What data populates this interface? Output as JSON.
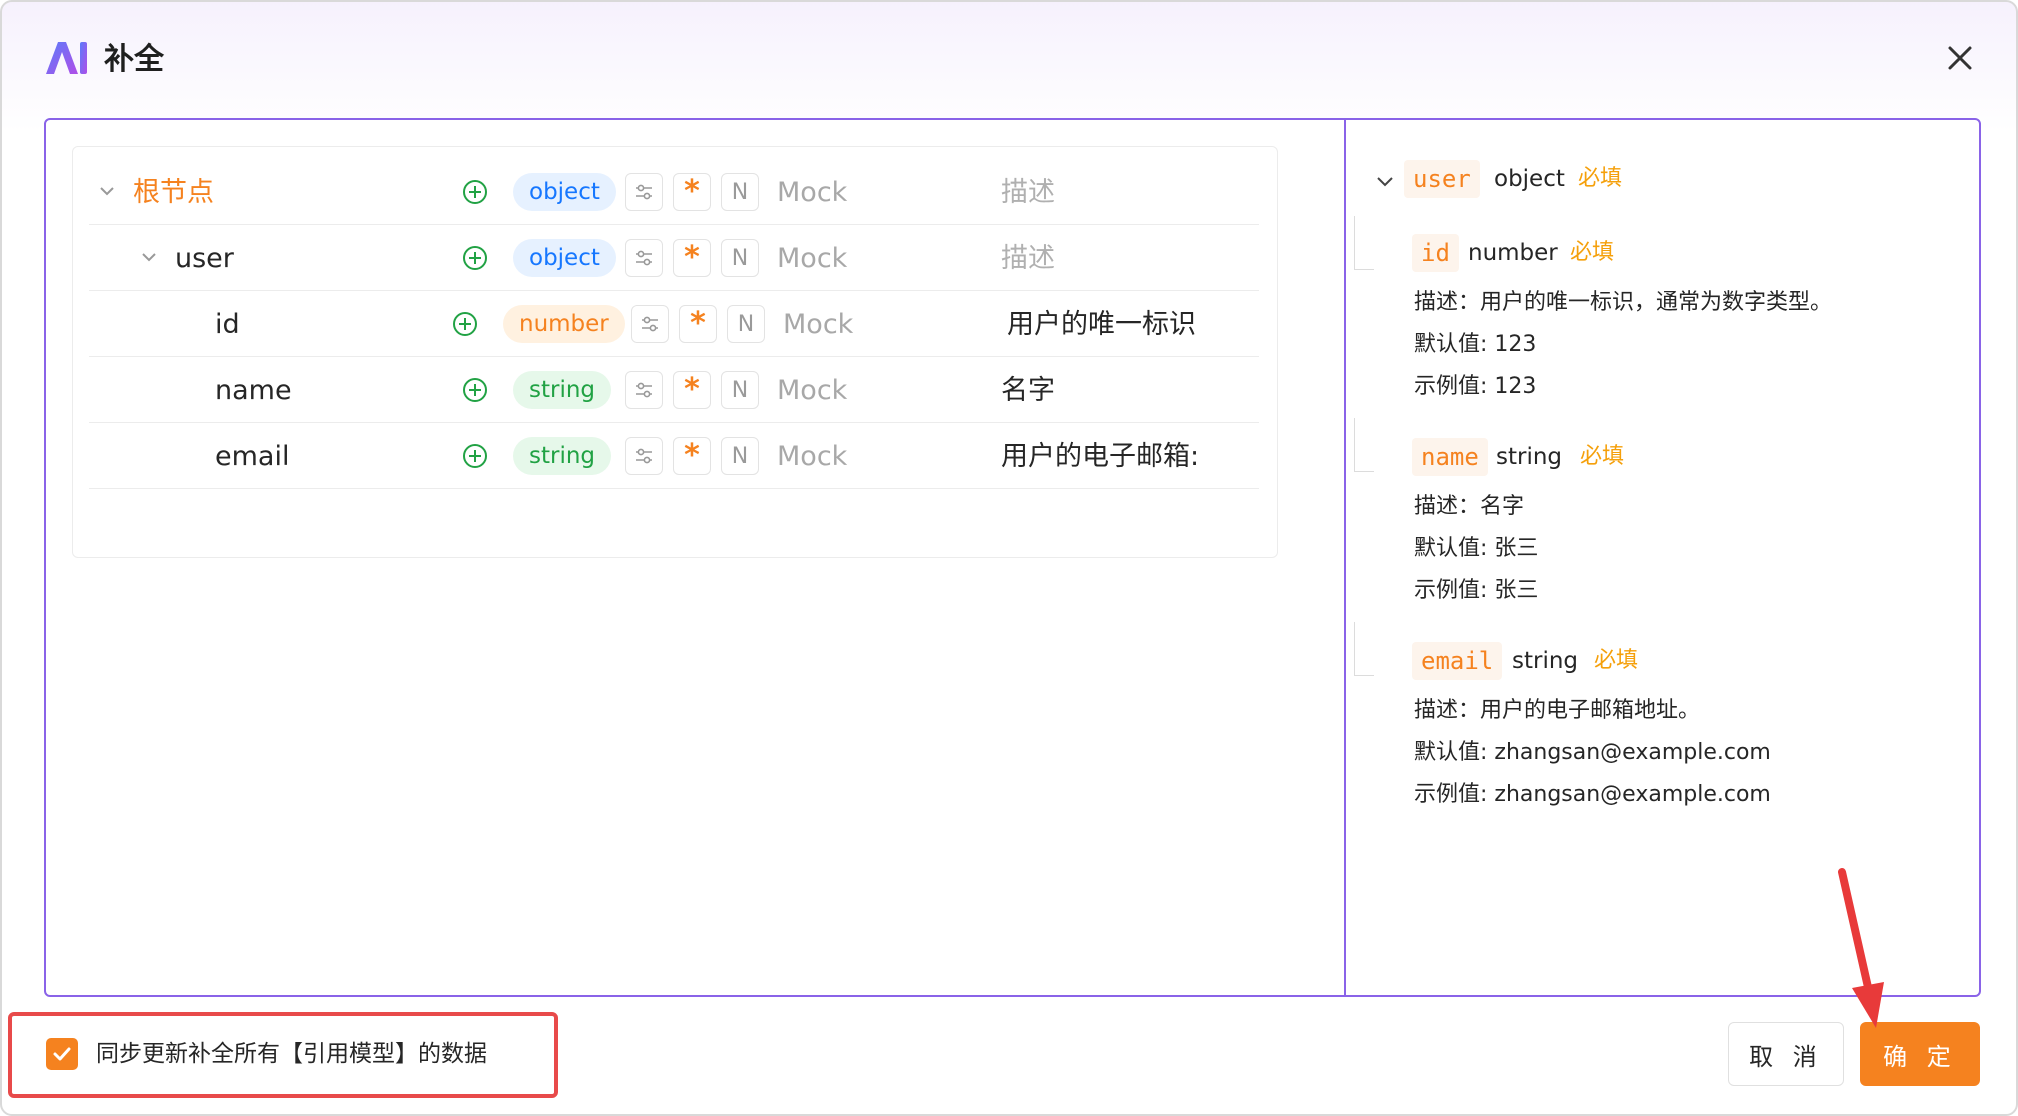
{
  "dialog": {
    "title": "补全",
    "logo_text": "AI",
    "close_icon": "close-icon",
    "accent_color": "#8a63e8",
    "brand_color": "#f5821f"
  },
  "editor": {
    "rows": [
      {
        "name": "根节点",
        "type": "object",
        "mock": "Mock",
        "desc": "描述",
        "desc_placeholder": true,
        "expandable": true
      },
      {
        "name": "user",
        "type": "object",
        "mock": "Mock",
        "desc": "描述",
        "desc_placeholder": true,
        "expandable": true
      },
      {
        "name": "id",
        "type": "number",
        "mock": "Mock",
        "desc": "用户的唯一标识",
        "desc_placeholder": false,
        "expandable": false
      },
      {
        "name": "name",
        "type": "string",
        "mock": "Mock",
        "desc": "名字",
        "desc_placeholder": false,
        "expandable": false
      },
      {
        "name": "email",
        "type": "string",
        "mock": "Mock",
        "desc": "用户的电子邮箱:",
        "desc_placeholder": false,
        "expandable": false
      }
    ],
    "required_glyph": "*",
    "nullable_glyph": "N"
  },
  "preview": {
    "root": {
      "key": "user",
      "type": "object",
      "required": "必填"
    },
    "fields": [
      {
        "key": "id",
        "type": "number",
        "required": "必填",
        "desc": "描述：用户的唯一标识，通常为数字类型。",
        "default": "默认值:   123",
        "example": "示例值:   123"
      },
      {
        "key": "name",
        "type": "string",
        "required": "必填",
        "desc": "描述：名字",
        "default": "默认值:   张三",
        "example": "示例值:   张三"
      },
      {
        "key": "email",
        "type": "string",
        "required": "必填",
        "desc": "描述：用户的电子邮箱地址。",
        "default": "默认值:   zhangsan@example.com",
        "example": "示例值:   zhangsan@example.com"
      }
    ]
  },
  "footer": {
    "sync_label": "同步更新补全所有【引用模型】的数据",
    "sync_checked": true,
    "cancel_label": "取 消",
    "ok_label": "确 定"
  }
}
